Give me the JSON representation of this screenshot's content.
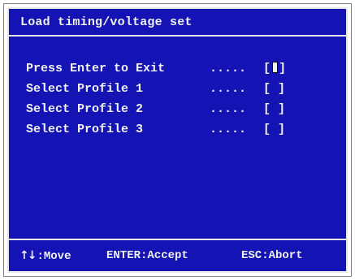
{
  "dialog": {
    "title": "Load timing/voltage set"
  },
  "menu": {
    "items": [
      {
        "label": "Press Enter to Exit",
        "dots": ".....",
        "value_open": "[",
        "value_close": "]",
        "selected": true
      },
      {
        "label": "Select Profile 1",
        "dots": ".....",
        "value": "[ ]",
        "selected": false
      },
      {
        "label": "Select Profile 2",
        "dots": ".....",
        "value": "[ ]",
        "selected": false
      },
      {
        "label": "Select Profile 3",
        "dots": ".....",
        "value": "[ ]",
        "selected": false
      }
    ]
  },
  "footer": {
    "move_icon": "up-down-arrows-icon",
    "move_glyph": "↑↓",
    "move_label": ":Move",
    "accept_label": "ENTER:Accept",
    "abort_label": "ESC:Abort"
  },
  "colors": {
    "background": "#1414b4",
    "text": "#f0f0f0",
    "border": "#e6e6e6"
  }
}
